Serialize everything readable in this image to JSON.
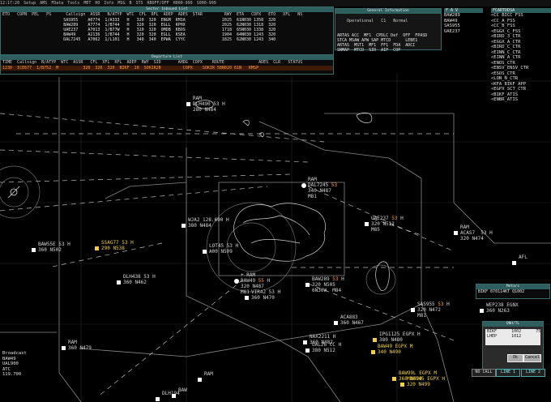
{
  "topbar": {
    "items": [
      "12:17:20",
      "Setup",
      "AMS",
      "FData",
      "Tools",
      "MET",
      "HO",
      "Info",
      "MSG",
      "B",
      "STS",
      "RBOFF/OFF",
      "H000-999",
      "S000-999"
    ]
  },
  "sector_inbound": {
    "title": "Sector Inbound List",
    "headers": "ETO   COPN  PEL   PS      Callsign  ASSR   N/ATYP  WTC  CFL  RFL  ADEP  ADES  STAR         RWY  ETA   COPX   ETO   XFL   NS",
    "rows": [
      "                         SAS955    A0774  1/A333   H   320  320  ENGM  KMIA               2025  61N030 1358  320",
      "                         BAW289    A7774  1/B744   H   320  320  EGLL  KPHX               2025  62N030 1318  320",
      "                         UAE237    A7013  1/B77W   H   320  320  OMDB  KBOS               1718  65N030 1338  320",
      "                         BAW49     A2136  1/B744   H   320  320  EGLL  KSEA               1904  64N030 1243  320",
      "                         DAL7245   A7062  1/L101   H   340  340  EPWA  CYYC               1825  62N030 1243  340"
    ]
  },
  "departure_list": {
    "title": "Departure List",
    "headers": "TIME  Callsign  N/ATYP  WTC  ASSR   CFL  XFL  RFL  ADEP  RWY  SID       AHDG  COPX    ROUTE              ADES  CLR   STATUS",
    "row": "1230  ICE677  1/B752  M          320  320  320  BIKF  10  SOKIR2B         COPX    SOKIR 58N020 61N   KMSP"
  },
  "general_info": {
    "title": "General Information",
    "row1": [
      "Operational",
      "C1",
      "Normal"
    ],
    "grid": [
      [
        "ARTAS ACC",
        "MF1",
        "CPDLC Def",
        "OFF",
        "FPASD"
      ],
      [
        "STCA MSAW APW SAP MTCD",
        "",
        "",
        "LEBE1",
        ""
      ],
      [
        "ARTAS",
        "MST1",
        "MF1",
        "FF1",
        "FDA",
        "ADCI"
      ],
      [
        "SNMAP",
        "MTCD",
        "SIR",
        "AIP",
        "COP",
        ""
      ]
    ]
  },
  "fav_panel": {
    "title": "F A V",
    "items": [
      "BAW289",
      "BAW49",
      "SAS955",
      "UAE237"
    ]
  },
  "freq_panel": {
    "title": "FCARTDDSA",
    "items": [
      "<CC BICC FSS",
      "<CC_A_FSS",
      "<CC_B_FSS",
      "<EGGX_C_FSS",
      "<BIRD_3_CTR",
      "<EGGX_A_CTR",
      "<BIRD_C_CTR",
      "<EINN_C_CTR",
      "<EINN_A_CTR",
      "<ENOS_CTR",
      "<ENSV_ENSV_CTR",
      "<ESOS_CTR",
      "<LON_N_CTR",
      "<KFA BIKF APP",
      "<EGPX SCT_CTR",
      "<BIKF_ATIS",
      "<ENBR_ATIS"
    ]
  },
  "left_panel": {
    "broadcast": "Broadcast",
    "items": [
      "BAW49",
      "UAL900",
      "ATC",
      "119.700"
    ]
  },
  "metars": {
    "title": "Metars",
    "line": "BIKF 070114KT Q1002"
  },
  "qnh": {
    "title": "QNH/TL",
    "rows": [
      [
        "BIKF",
        "1002",
        "75"
      ],
      [
        "LHEP",
        "1012",
        ""
      ]
    ],
    "ok_label": "Ok",
    "cancel_label": "Cancel"
  },
  "bottom_bar": {
    "no_call": "NO CALL",
    "line1": "LINE 1",
    "line2": "LINE 2"
  },
  "aircraft": [
    {
      "id": "DAL7245",
      "l1": "RAM",
      "l2": "DAL7245 ",
      "lvl": "53",
      "l3": "340 N487",
      "l4": "M81",
      "color": "white",
      "hl": true
    },
    {
      "id": "UAE237",
      "l1": "",
      "l2": "UAE237 ",
      "lvl": "53",
      "suffix": " H",
      "l3": "320 N512",
      "l4": "M85",
      "color": "white"
    },
    {
      "id": "BAW289",
      "l1": "",
      "l2": "BAW289 ",
      "lvl": "53",
      "suffix": " H",
      "l3": "320 N505",
      "l4": "6N30W  M84",
      "color": "white"
    },
    {
      "id": "BAW49",
      "l1": "+ RAM",
      "l2": "BAW49 ",
      "lvl": "55",
      "suffix": " H",
      "l3": "320 N487",
      "l4": "M81",
      "color": "white"
    },
    {
      "id": "SAS955",
      "l1": "",
      "l2": "SAS955 ",
      "lvl": "53",
      "suffix": " H",
      "l3": "320 N472",
      "l4": "M81",
      "color": "white"
    },
    {
      "id": "SSAG77",
      "l2": "SSAG77 53 H",
      "l3": "290 N538",
      "color": "yellow"
    },
    {
      "id": "BAW55E",
      "l2": "BAW55E 53 H",
      "l3": "360 N502",
      "color": "white"
    },
    {
      "id": "DLH490",
      "l1": "RAM",
      "l2": "DLH490 53 H",
      "l3": "280 N484",
      "color": "white"
    },
    {
      "id": "WJA2",
      "l2": "WJA2 128.600 H",
      "l3": "380 N484",
      "color": "white"
    },
    {
      "id": "LOT45",
      "l2": "LOT45 53 H",
      "l3": "A00 N509",
      "color": "white"
    },
    {
      "id": "DLH438",
      "l2": "DLH438 53 H",
      "l3": "360 N462",
      "color": "white"
    },
    {
      "id": "VIR42",
      "l2": "VIR42 53 H",
      "l3": "360 N470",
      "color": "white"
    },
    {
      "id": "ACAS7",
      "l1": "RAM",
      "l2": "ACAS7  53 H",
      "l3": "320 N474",
      "color": "white"
    },
    {
      "id": "AFL",
      "l2": "AFL",
      "l3": "",
      "color": "white"
    },
    {
      "id": "WEP238",
      "l2": "WEP238 EGNX",
      "l3": "360 N263",
      "color": "white"
    },
    {
      "id": "ACA883",
      "l2": "ACA883",
      "l3": "360 N467",
      "color": "white"
    },
    {
      "id": "NAX2211",
      "l2": "NAX2211 H",
      "l3": "360 N482",
      "color": "white"
    },
    {
      "id": "UAL26",
      "l2": "UAL26 CC H",
      "l3": "380 N512",
      "color": "white"
    },
    {
      "id": "IPG1125",
      "l2": "IPG1125 EGPX H",
      "l3": "380 N480",
      "color": "white"
    },
    {
      "id": "BAW49y",
      "l2": "BAW49 EGPX M",
      "l3": "340 N490",
      "color": "yellow"
    },
    {
      "id": "BAW99L",
      "l2": "BAW99L EGPX M",
      "l3": "360 N499",
      "color": "yellow"
    },
    {
      "id": "AMB0145",
      "l2": "MB0145 EGPX H",
      "l3": "320 N499",
      "color": "yellow"
    },
    {
      "id": "RAM1",
      "l2": "RAM",
      "l3": "360 N479",
      "color": "white"
    },
    {
      "id": "RAM2",
      "l2": "RAM",
      "l3": "",
      "color": "white"
    },
    {
      "id": "DLH194",
      "l2": "DLH194",
      "l3": "",
      "color": "white"
    },
    {
      "id": "BAW_top",
      "l2": "BAW",
      "l3": "",
      "color": "white"
    }
  ]
}
